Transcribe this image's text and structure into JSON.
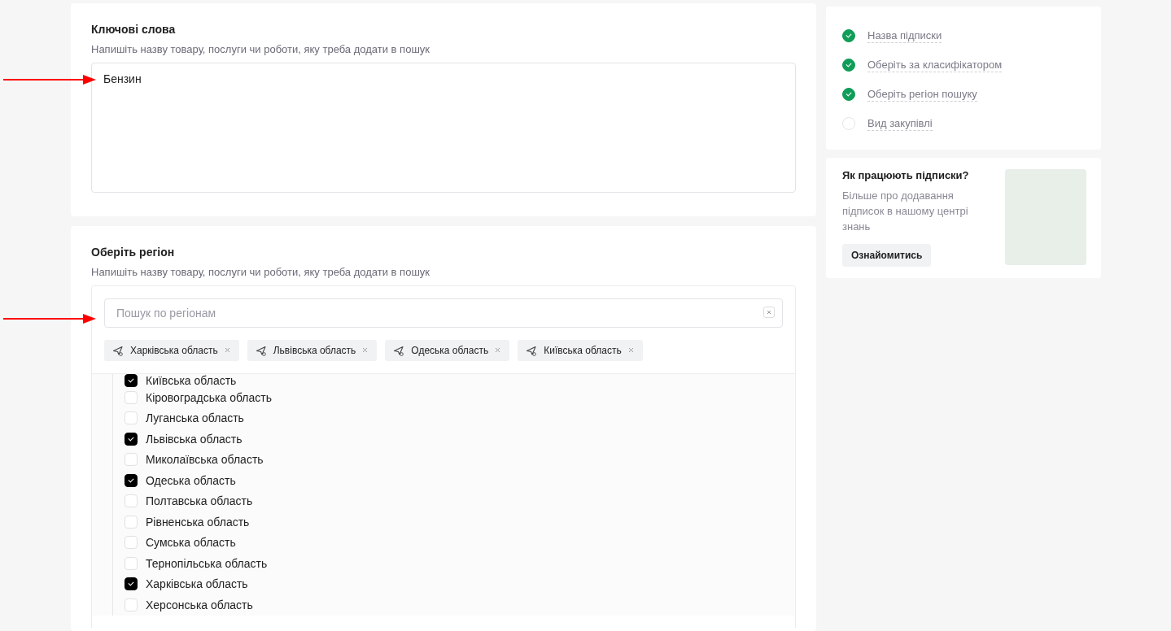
{
  "keywords": {
    "title": "Ключові слова",
    "hint": "Напишіть назву товару, послуги чи роботи, яку треба додати в пошук",
    "value": "Бензин"
  },
  "region": {
    "title": "Оберіть регіон",
    "hint": "Напишіть назву товару, послуги чи роботи, яку треба додати в пошук",
    "search_placeholder": "Пошук по регіонам",
    "chips": [
      {
        "label": "Харківська область"
      },
      {
        "label": "Львівська область"
      },
      {
        "label": "Одеська область"
      },
      {
        "label": "Київська область"
      }
    ],
    "items": [
      {
        "label": "Київська область",
        "checked": true
      },
      {
        "label": "Кіровоградська область",
        "checked": false
      },
      {
        "label": "Луганська область",
        "checked": false
      },
      {
        "label": "Львівська область",
        "checked": true
      },
      {
        "label": "Миколаївська область",
        "checked": false
      },
      {
        "label": "Одеська область",
        "checked": true
      },
      {
        "label": "Полтавська область",
        "checked": false
      },
      {
        "label": "Рівненська область",
        "checked": false
      },
      {
        "label": "Сумська область",
        "checked": false
      },
      {
        "label": "Тернопільська область",
        "checked": false
      },
      {
        "label": "Харківська область",
        "checked": true
      },
      {
        "label": "Херсонська область",
        "checked": false
      }
    ]
  },
  "steps": [
    {
      "label": "Назва підписки",
      "done": true
    },
    {
      "label": "Оберіть за класифікатором",
      "done": true
    },
    {
      "label": "Оберіть регіон пошуку",
      "done": true
    },
    {
      "label": "Вид закупівлі",
      "done": false
    }
  ],
  "help": {
    "title": "Як працюють підписки?",
    "text": "Більше про додавання підписок в нашому центрі знань",
    "button": "Ознайомитись"
  }
}
